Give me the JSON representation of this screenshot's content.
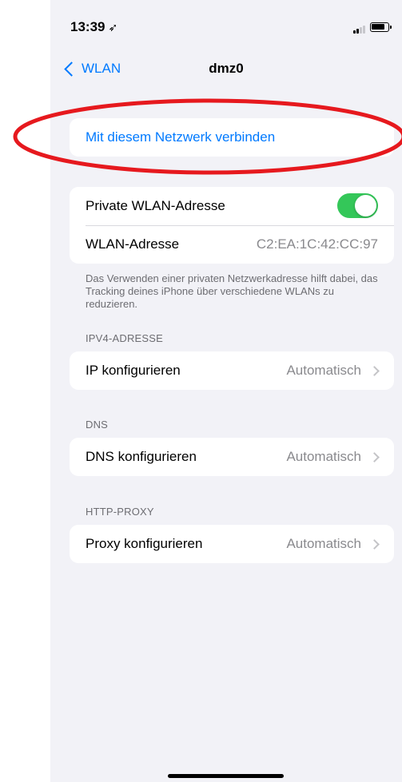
{
  "status_bar": {
    "time": "13:39",
    "location_icon": "location-arrow-icon",
    "signal_icon": "cellular-signal-icon",
    "battery_icon": "battery-icon"
  },
  "nav": {
    "back_label": "WLAN",
    "title": "dmz0"
  },
  "connect_group": {
    "connect_label": "Mit diesem Netzwerk verbinden"
  },
  "privacy_group": {
    "private_address_label": "Private WLAN-Adresse",
    "private_address_enabled": true,
    "wlan_address_label": "WLAN-Adresse",
    "wlan_address_value": "C2:EA:1C:42:CC:97",
    "footnote": "Das Verwenden einer privaten Netzwerkadresse hilft dabei, das Tracking deines iPhone über verschiedene WLANs zu reduzieren."
  },
  "ipv4": {
    "header": "IPV4-ADRESSE",
    "row_label": "IP konfigurieren",
    "row_value": "Automatisch"
  },
  "dns": {
    "header": "DNS",
    "row_label": "DNS konfigurieren",
    "row_value": "Automatisch"
  },
  "proxy": {
    "header": "HTTP-PROXY",
    "row_label": "Proxy konfigurieren",
    "row_value": "Automatisch"
  },
  "colors": {
    "accent": "#007aff",
    "toggle_on": "#34c759",
    "background": "#f2f2f7",
    "highlight": "#e6191e"
  }
}
